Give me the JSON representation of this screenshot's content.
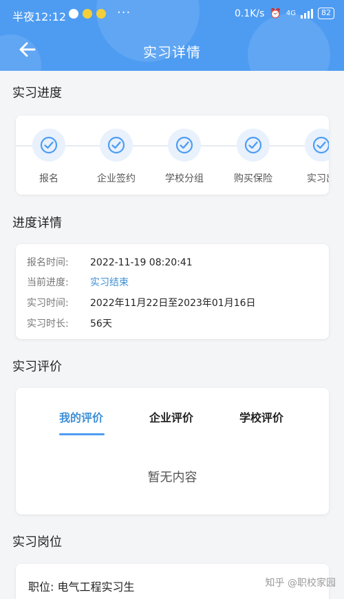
{
  "status_bar": {
    "time": "半夜12:12",
    "network_speed": "0.1K/s",
    "signal_label": "4G",
    "battery": "82"
  },
  "nav": {
    "title": "实习详情",
    "back_icon": "arrow-left-icon"
  },
  "progress": {
    "heading": "实习进度",
    "steps": [
      {
        "label": "报名",
        "icon": "check-circle-icon"
      },
      {
        "label": "企业签约",
        "icon": "check-circle-icon"
      },
      {
        "label": "学校分组",
        "icon": "check-circle-icon"
      },
      {
        "label": "购买保险",
        "icon": "check-circle-icon"
      },
      {
        "label": "实习出",
        "icon": "check-circle-icon"
      }
    ]
  },
  "details": {
    "heading": "进度详情",
    "rows": [
      {
        "key": "报名时间:",
        "value": "2022-11-19 08:20:41"
      },
      {
        "key": "当前进度:",
        "value": "实习结束"
      },
      {
        "key": "实习时间:",
        "value": "2022年11月22日至2023年01月16日"
      },
      {
        "key": "实习时长:",
        "value": "56天"
      }
    ]
  },
  "evaluation": {
    "heading": "实习评价",
    "tabs": [
      "我的评价",
      "企业评价",
      "学校评价"
    ],
    "active_tab": "我的评价",
    "empty_text": "暂无内容"
  },
  "position": {
    "heading": "实习岗位",
    "job": "职位:  电气工程实习生"
  },
  "watermark": "知乎 @职校家园",
  "colors": {
    "primary": "#4e9cf2",
    "link": "#3d8fd6"
  }
}
